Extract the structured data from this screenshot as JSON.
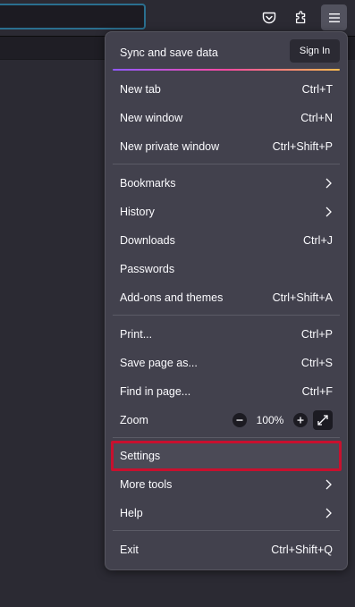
{
  "menu": {
    "sync_label": "Sync and save data",
    "sign_in_label": "Sign In",
    "items": [
      {
        "label": "New tab",
        "shortcut": "Ctrl+T"
      },
      {
        "label": "New window",
        "shortcut": "Ctrl+N"
      },
      {
        "label": "New private window",
        "shortcut": "Ctrl+Shift+P"
      },
      {
        "label": "Bookmarks",
        "shortcut": ""
      },
      {
        "label": "History",
        "shortcut": ""
      },
      {
        "label": "Downloads",
        "shortcut": "Ctrl+J"
      },
      {
        "label": "Passwords",
        "shortcut": ""
      },
      {
        "label": "Add-ons and themes",
        "shortcut": "Ctrl+Shift+A"
      },
      {
        "label": "Print...",
        "shortcut": "Ctrl+P"
      },
      {
        "label": "Save page as...",
        "shortcut": "Ctrl+S"
      },
      {
        "label": "Find in page...",
        "shortcut": "Ctrl+F"
      },
      {
        "label": "Zoom",
        "shortcut": ""
      },
      {
        "label": "Settings",
        "shortcut": ""
      },
      {
        "label": "More tools",
        "shortcut": ""
      },
      {
        "label": "Help",
        "shortcut": ""
      },
      {
        "label": "Exit",
        "shortcut": "Ctrl+Shift+Q"
      }
    ],
    "zoom": {
      "value": "100%",
      "minus_glyph": "−",
      "plus_glyph": "+"
    }
  },
  "toolbar": {
    "icons": [
      "pocket-icon",
      "extensions-icon",
      "hamburger-menu-icon"
    ]
  },
  "colors": {
    "menu_bg": "#42414d",
    "highlight": "#c8102e",
    "sync_gradient": [
      "#9059ff",
      "#ff4aa2",
      "#ffbd4f"
    ]
  }
}
